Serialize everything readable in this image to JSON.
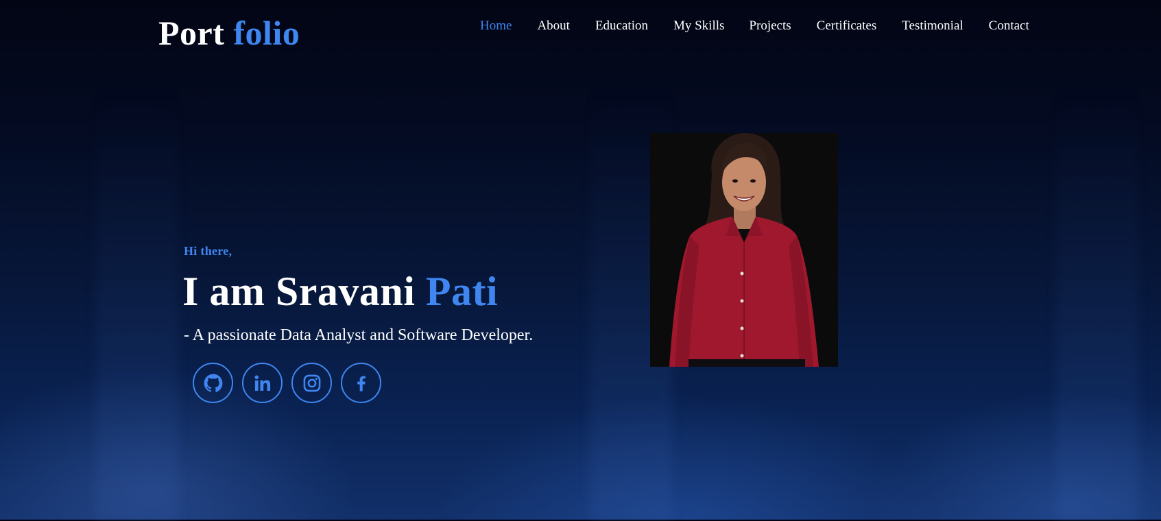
{
  "header": {
    "logo_part1": "Port",
    "logo_part2": "folio",
    "nav": [
      {
        "label": "Home",
        "active": true
      },
      {
        "label": "About"
      },
      {
        "label": "Education"
      },
      {
        "label": "My Skills"
      },
      {
        "label": "Projects"
      },
      {
        "label": "Certificates"
      },
      {
        "label": "Testimonial"
      },
      {
        "label": "Contact"
      }
    ]
  },
  "hero": {
    "greeting": "Hi there,",
    "headline_part1": "I am Sravani",
    "headline_part2": "Pati",
    "tagline": "- A passionate Data Analyst and Software Developer.",
    "socials": [
      {
        "icon": "github-icon"
      },
      {
        "icon": "linkedin-icon"
      },
      {
        "icon": "instagram-icon"
      },
      {
        "icon": "facebook-icon"
      }
    ],
    "photo": {
      "icon": "profile-photo"
    }
  },
  "colors": {
    "accent": "#3f86f0",
    "text": "#ffffff",
    "background_top": "#020514",
    "background_bottom": "#12306a",
    "shirt": "#a0182e"
  }
}
